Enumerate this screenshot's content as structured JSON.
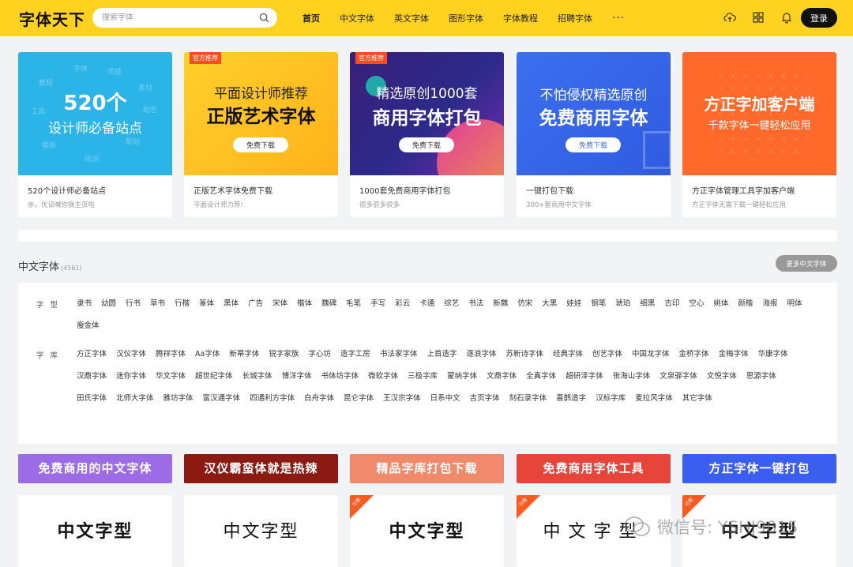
{
  "header": {
    "logo": "字体天下",
    "search_placeholder": "搜索字体",
    "nav": [
      "首页",
      "中文字体",
      "英文字体",
      "图形字体",
      "字体教程",
      "招聘字体"
    ],
    "nav_more": "···",
    "login": "登录"
  },
  "banners": [
    {
      "big1": "520个",
      "big2": "设计师必备站点",
      "title": "520个设计师必备站点",
      "sub": "亲，优设喊你换主页啦",
      "words": [
        "字体",
        "灵感",
        "教程",
        "素材",
        "工具",
        "模板",
        "配色",
        "培训",
        "酷站"
      ]
    },
    {
      "tag": "官方推荐",
      "big1": "平面设计师推荐",
      "big2": "正版艺术字体",
      "button": "免费下载",
      "title": "正版艺术字体免费下载",
      "sub": "平面设计师力荐!"
    },
    {
      "tag": "官方推荐",
      "big1": "精选原创1000套",
      "big2": "商用字体打包",
      "button": "免费下载",
      "title": "1000套免费商用字体打包",
      "sub": "很多很多很多"
    },
    {
      "big1": "不怕侵权精选原创",
      "big2": "免费商用字体",
      "button": "免费下载",
      "title": "一键打包下载",
      "sub": "300+套商用中文字体"
    },
    {
      "big1": "方正字加客户端",
      "big2": "千款字体一键轻松应用",
      "title": "方正字体管理工具字加客户端",
      "sub": "方正字体无需下载一键轻松应用"
    }
  ],
  "section": {
    "title": "中文字体",
    "count": "(4561)",
    "more_button": "更多中文字体",
    "type_label": "字型",
    "types": [
      "隶书",
      "幼圆",
      "行书",
      "草书",
      "行楷",
      "篆体",
      "黑体",
      "广告",
      "宋体",
      "楷体",
      "魏碑",
      "毛笔",
      "手写",
      "彩云",
      "卡通",
      "综艺",
      "书法",
      "新魏",
      "仿宋",
      "大黑",
      "娃娃",
      "钢笔",
      "琥珀",
      "细黑",
      "古印",
      "空心",
      "姚体",
      "颜楷",
      "海报",
      "明体",
      "瘦金体"
    ],
    "lib_label": "字库",
    "libs": [
      "方正字体",
      "汉仪字体",
      "腾祥字体",
      "Aa字体",
      "新蒂字体",
      "锐字家族",
      "字心坊",
      "造字工房",
      "书法家字体",
      "上首造字",
      "逐浪字体",
      "苏新诗字体",
      "经典字体",
      "创艺字体",
      "中国龙字体",
      "金桥字体",
      "金梅字体",
      "华康字体",
      "汉鼎字体",
      "迷你字体",
      "华文字体",
      "超世纪字体",
      "长城字体",
      "博洋字体",
      "书体坊字体",
      "微软字体",
      "三极字库",
      "蒙纳字体",
      "文鼎字体",
      "全真字体",
      "超研泽字体",
      "张海山字体",
      "文泉驿字体",
      "文悦字体",
      "思源字体",
      "田氏字体",
      "北师大字体",
      "雅坊字体",
      "富汉通字体",
      "四通利方字体",
      "白舟字体",
      "昆仑字体",
      "王汉宗字体",
      "日系中文",
      "吉页字体",
      "刻石录字体",
      "喜鹊造字",
      "汉标字库",
      "麦拉风字体",
      "其它字体"
    ]
  },
  "promo_buttons": [
    {
      "label": "免费商用的中文字体",
      "color": "#9b6be8"
    },
    {
      "label": "汉仪霸蛮体就是热辣",
      "color": "#8a1a12"
    },
    {
      "label": "精品字库打包下载",
      "color": "#f08a6a"
    },
    {
      "label": "免费商用字体工具",
      "color": "#e8453a"
    },
    {
      "label": "方正字体一键打包",
      "color": "#3a5ef0"
    }
  ],
  "previews": [
    {
      "text": "中文字型"
    },
    {
      "text": "中文字型"
    },
    {
      "text": "中文字型",
      "corner": "付费"
    },
    {
      "text": "中文字型",
      "corner": "付费"
    },
    {
      "text": "中文字型",
      "corner": "付费"
    }
  ],
  "watermark": "微信号: YSHJ9015",
  "colors": {
    "header": "#ffd21f",
    "accent_tag": "#ff4c1f"
  }
}
